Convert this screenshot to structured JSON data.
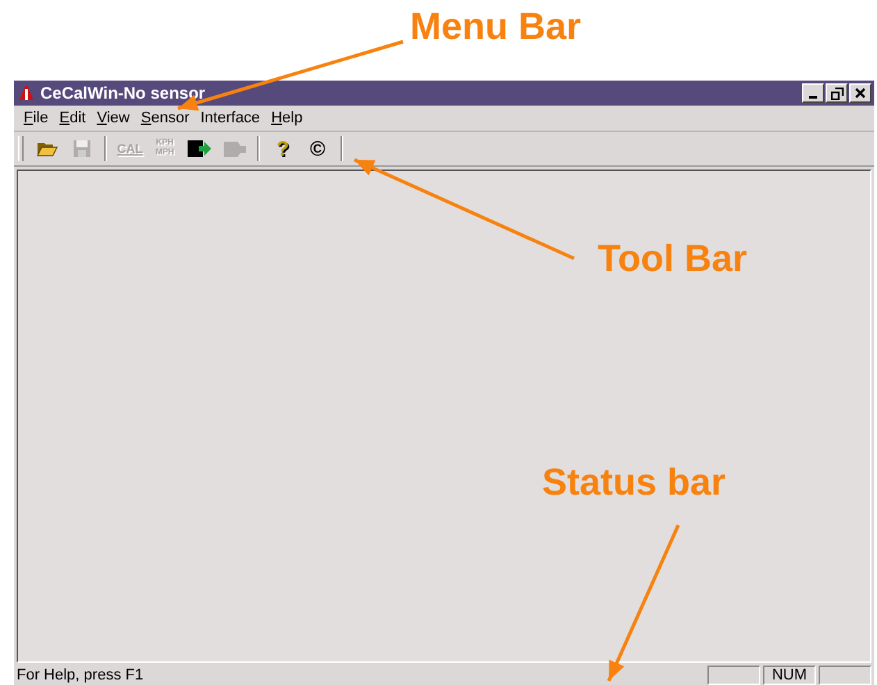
{
  "window": {
    "title": "CeCalWin-No sensor"
  },
  "menu_bar": [
    {
      "label": "File",
      "underlined": true
    },
    {
      "label": "Edit",
      "underlined": true
    },
    {
      "label": "View",
      "underlined": true
    },
    {
      "label": "Sensor",
      "underlined": true
    },
    {
      "label": "Interface",
      "underlined": false
    },
    {
      "label": "Help",
      "underlined": true
    }
  ],
  "toolbar": [
    {
      "kind": "open",
      "disabled": false
    },
    {
      "kind": "save",
      "disabled": true
    },
    {
      "kind": "separator"
    },
    {
      "kind": "glyph",
      "glyph": "CAL",
      "disabled": true
    },
    {
      "kind": "units",
      "glyph": "KPH",
      "glyph_2": "MPH",
      "disabled": true
    },
    {
      "kind": "send",
      "disabled": false
    },
    {
      "kind": "receive",
      "disabled": true
    },
    {
      "kind": "separator"
    },
    {
      "kind": "char",
      "glyph": "?",
      "disabled": false
    },
    {
      "kind": "char",
      "glyph": "©",
      "disabled": false
    }
  ],
  "status_bar": {
    "message": "For Help, press F1",
    "panes": [
      {
        "kind": "blank"
      },
      {
        "kind": "text",
        "text": "NUM"
      },
      {
        "kind": "blank"
      }
    ]
  },
  "callouts": [
    {
      "label": "Menu Bar"
    },
    {
      "label": "Tool Bar"
    },
    {
      "label": "Status bar"
    }
  ]
}
